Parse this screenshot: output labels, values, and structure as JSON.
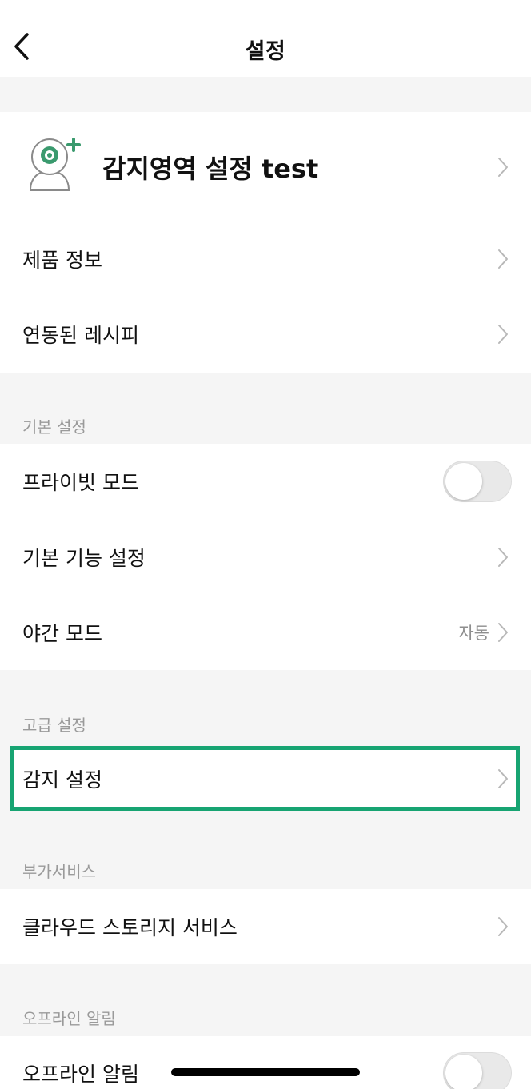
{
  "header": {
    "title": "설정",
    "back_icon": "chevron-left-icon"
  },
  "device": {
    "name": "감지영역 설정 test",
    "avatar_icon": "camera-add-icon",
    "accent_color": "#3a9a6e"
  },
  "main_items": [
    {
      "label": "제품 정보"
    },
    {
      "label": "연동된 레시피"
    }
  ],
  "basic_section": {
    "title": "기본 설정",
    "items": [
      {
        "label": "프라이빗 모드",
        "toggle": false
      },
      {
        "label": "기본 기능 설정"
      },
      {
        "label": "야간 모드",
        "value": "자동"
      }
    ]
  },
  "advanced_section": {
    "title": "고급 설정",
    "items": [
      {
        "label": "감지 설정",
        "highlight_color": "#17a472"
      }
    ]
  },
  "extra_section": {
    "title": "부가서비스",
    "items": [
      {
        "label": "클라우드 스토리지 서비스"
      }
    ]
  },
  "offline_section": {
    "title": "오프라인 알림",
    "items": [
      {
        "label": "오프라인 알림",
        "toggle": false
      }
    ]
  }
}
